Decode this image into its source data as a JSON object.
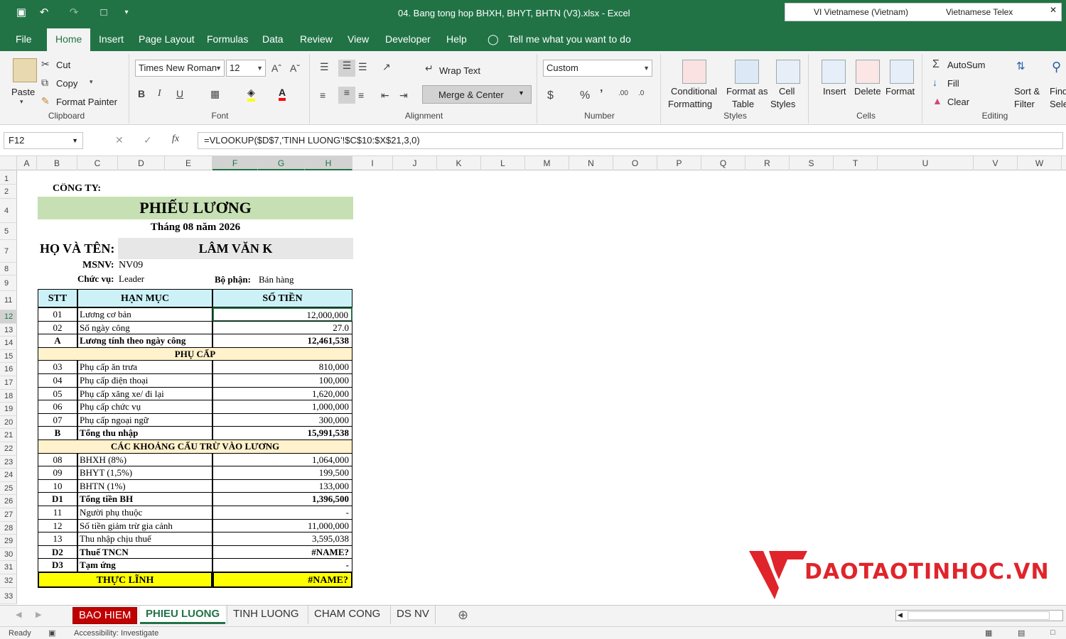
{
  "window": {
    "title": "04. Bang tong hop BHXH, BHYT, BHTN (V3).xlsx  -  Excel",
    "ime_language": "VI  Vietnamese (Vietnam)",
    "ime_method": "Vietnamese Telex"
  },
  "menu_tabs": [
    "File",
    "Home",
    "Insert",
    "Page Layout",
    "Formulas",
    "Data",
    "Review",
    "View",
    "Developer",
    "Help"
  ],
  "tell_me": "Tell me what you want to do",
  "ribbon": {
    "clipboard": {
      "paste": "Paste",
      "cut": "Cut",
      "copy": "Copy",
      "format_painter": "Format Painter",
      "label": "Clipboard"
    },
    "font": {
      "family": "Times New Roman",
      "size": "12",
      "label": "Font"
    },
    "alignment": {
      "wrap": "Wrap Text",
      "merge": "Merge & Center",
      "label": "Alignment"
    },
    "number": {
      "format": "Custom",
      "label": "Number"
    },
    "styles": {
      "conditional": "Conditional",
      "conditional2": "Formatting",
      "format_as": "Format as",
      "format_as2": "Table",
      "cell_styles": "Cell",
      "cell_styles2": "Styles",
      "label": "Styles"
    },
    "cells": {
      "insert": "Insert",
      "delete": "Delete",
      "format": "Format",
      "label": "Cells"
    },
    "editing": {
      "autosum": "AutoSum",
      "fill": "Fill",
      "clear": "Clear",
      "sort": "Sort &",
      "sort2": "Filter",
      "find": "Find",
      "find2": "Sele",
      "label": "Editing"
    }
  },
  "formula_bar": {
    "cell_ref": "F12",
    "formula": "=VLOOKUP($D$7,'TINH LUONG'!$C$10:$X$21,3,0)"
  },
  "columns": [
    "A",
    "B",
    "C",
    "D",
    "E",
    "F",
    "G",
    "H",
    "I",
    "J",
    "K",
    "L",
    "M",
    "N",
    "O",
    "P",
    "Q",
    "R",
    "S",
    "T",
    "U",
    "V",
    "W"
  ],
  "rows": [
    "1",
    "2",
    "4",
    "5",
    "7",
    "8",
    "9",
    "11",
    "12",
    "13",
    "14",
    "15",
    "16",
    "17",
    "18",
    "19",
    "20",
    "21",
    "22",
    "23",
    "24",
    "25",
    "26",
    "27",
    "28",
    "29",
    "30",
    "31",
    "32",
    "33"
  ],
  "sheet": {
    "company_label": "CÔNG TY:",
    "title": "PHIẾU LƯƠNG",
    "period": "Tháng 08 năm 2026",
    "name_label": "HỌ VÀ TÊN:",
    "name_value": "LÂM VĂN K",
    "id_label": "MSNV:",
    "id_value": "NV09",
    "position_label": "Chức vụ:",
    "position_value": "Leader",
    "dept_label": "Bộ phận:",
    "dept_value": "Bán hàng",
    "headers": [
      "STT",
      "HẠN MỤC",
      "SỐ TIỀN"
    ],
    "table": [
      {
        "stt": "01",
        "item": "Lương cơ bản",
        "amount": "12,000,000",
        "bold": false
      },
      {
        "stt": "02",
        "item": "Số ngày công",
        "amount": "27.0",
        "bold": false
      },
      {
        "stt": "A",
        "item": "Lương tính theo ngày công",
        "amount": "12,461,538",
        "bold": true
      },
      {
        "section": "PHỤ CẤP"
      },
      {
        "stt": "03",
        "item": "Phụ cấp ăn trưa",
        "amount": "810,000",
        "bold": false
      },
      {
        "stt": "04",
        "item": "Phụ cấp điện thoại",
        "amount": "100,000",
        "bold": false
      },
      {
        "stt": "05",
        "item": "Phụ cấp xăng xe/ đi lại",
        "amount": "1,620,000",
        "bold": false
      },
      {
        "stt": "06",
        "item": "Phụ cấp chức vụ",
        "amount": "1,000,000",
        "bold": false
      },
      {
        "stt": "07",
        "item": "Phụ cấp ngoại ngữ",
        "amount": "300,000",
        "bold": false
      },
      {
        "stt": "B",
        "item": "Tổng thu nhập",
        "amount": "15,991,538",
        "bold": true
      },
      {
        "section": "CÁC KHOẢNG CẤU TRỪ VÀO LƯƠNG"
      },
      {
        "stt": "08",
        "item": "BHXH (8%)",
        "amount": "1,064,000",
        "bold": false
      },
      {
        "stt": "09",
        "item": "BHYT (1,5%)",
        "amount": "199,500",
        "bold": false
      },
      {
        "stt": "10",
        "item": "BHTN (1%)",
        "amount": "133,000",
        "bold": false
      },
      {
        "stt": "D1",
        "item": "Tổng tiền BH",
        "amount": "1,396,500",
        "bold": true
      },
      {
        "stt": "11",
        "item": "Người phụ thuộc",
        "amount": "-",
        "bold": false
      },
      {
        "stt": "12",
        "item": "Số tiền giảm trừ gia cảnh",
        "amount": "11,000,000",
        "bold": false
      },
      {
        "stt": "13",
        "item": "Thu nhập chịu thuế",
        "amount": "3,595,038",
        "bold": false
      },
      {
        "stt": "D2",
        "item": "Thuế TNCN",
        "amount": "#NAME?",
        "bold": true
      },
      {
        "stt": "D3",
        "item": "Tạm ứng",
        "amount": "-",
        "bold": true
      }
    ],
    "net_label": "THỰC LĨNH",
    "net_value": "#NAME?"
  },
  "sheet_tabs": [
    "BAO HIEM",
    "PHIEU LUONG",
    "TINH LUONG",
    "CHAM CONG",
    "DS NV"
  ],
  "status": {
    "ready": "Ready",
    "accessibility": "Accessibility: Investigate"
  },
  "watermark": "DAOTAOTINHOC.VN",
  "colors": {
    "excel_green": "#217346",
    "title_fill": "#c6e0b4",
    "header_fill": "#ccf2f7",
    "section_fill": "#fff2cc",
    "net_fill": "#ffff00",
    "logo_red": "#e0242b"
  }
}
